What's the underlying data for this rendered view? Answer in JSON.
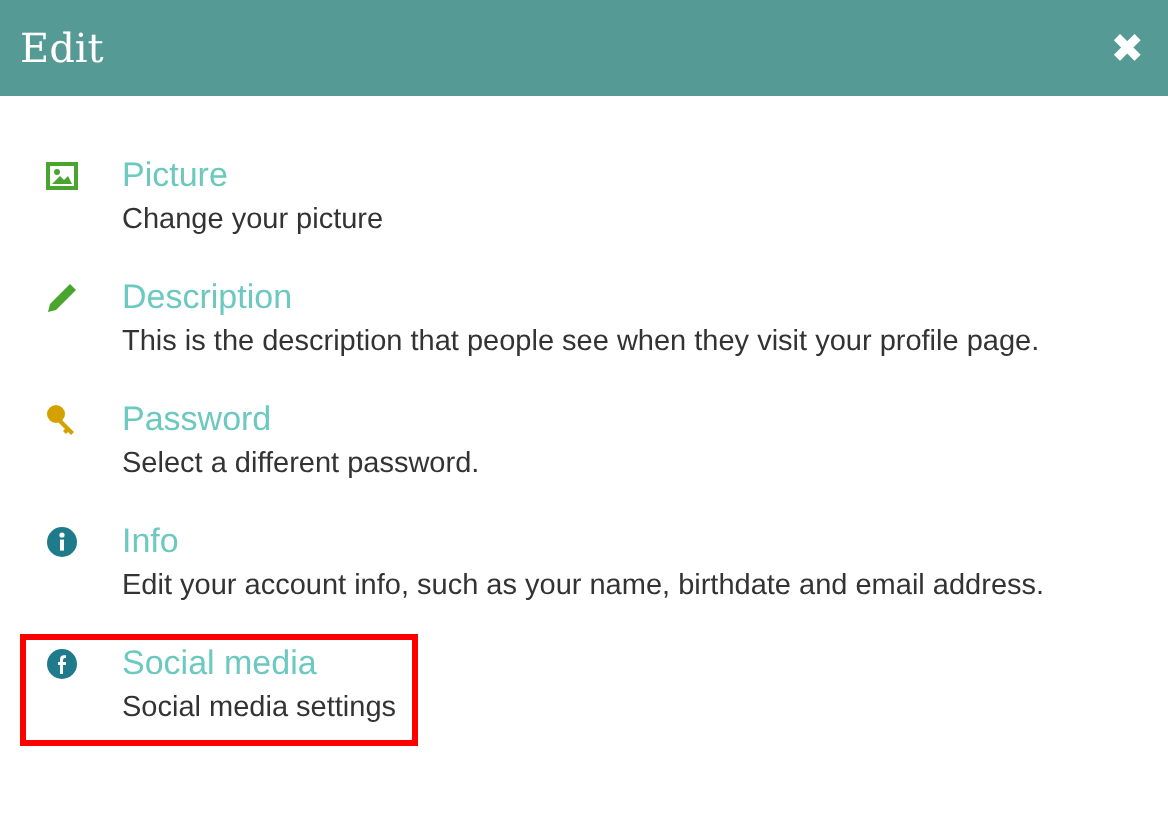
{
  "window": {
    "title": "Edit",
    "close": "✖"
  },
  "items": [
    {
      "kind": "picture",
      "title": "Picture",
      "description": "Change your picture",
      "highlighted": false
    },
    {
      "kind": "pencil",
      "title": "Description",
      "description": "This is the description that people see when they visit your profile page.",
      "highlighted": false
    },
    {
      "kind": "key",
      "title": "Password",
      "description": "Select a different password.",
      "highlighted": false
    },
    {
      "kind": "info",
      "title": "Info",
      "description": "Edit your account info, such as your name, birthdate and email address.",
      "highlighted": false
    },
    {
      "kind": "facebook",
      "title": "Social media",
      "description": "Social media settings",
      "highlighted": true
    }
  ]
}
